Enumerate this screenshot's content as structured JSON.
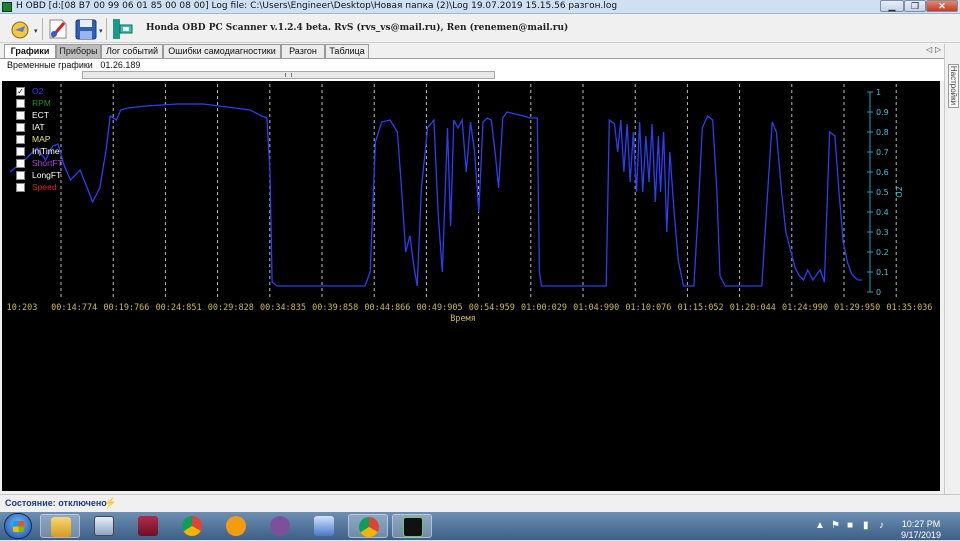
{
  "window": {
    "title": "H OBD [d:[08 B7 00 99 06 01 85 00 08 00] Log file: C:\\Users\\Engineer\\Desktop\\Новая папка (2)\\Log 19.07.2019 15.15.56 разгон.log",
    "controls": [
      "minimize",
      "maximize",
      "close"
    ]
  },
  "toolbar": {
    "app_title": "Honda OBD PC Scanner v.1.2.4 beta. RvS (rvs_vs@mail.ru), Ren (renemen@mail.ru)",
    "icons": [
      "connect-icon",
      "disconnect-icon",
      "save-icon",
      "settings-icon"
    ]
  },
  "tabs": [
    {
      "label": "Графики",
      "active": true
    },
    {
      "label": "Приборы",
      "active": false
    },
    {
      "label": "Лог событий",
      "active": false
    },
    {
      "label": "Ошибки самодиагностики",
      "active": false
    },
    {
      "label": "Разгон",
      "active": false
    },
    {
      "label": "Таблица",
      "active": false
    }
  ],
  "subheader": {
    "label": "Временные графики",
    "time": "01.26.189"
  },
  "side_panel": {
    "label": "Настройки"
  },
  "legend": [
    {
      "label": "O2",
      "checked": true,
      "color": "#2c3ff0"
    },
    {
      "label": "RPM",
      "checked": false,
      "color": "#2a8a2a"
    },
    {
      "label": "ECT",
      "checked": false,
      "color": "#ffffff"
    },
    {
      "label": "IAT",
      "checked": false,
      "color": "#ffffff"
    },
    {
      "label": "MAP",
      "checked": false,
      "color": "#e8e27a"
    },
    {
      "label": "InjTime",
      "checked": false,
      "color": "#ffffff"
    },
    {
      "label": "ShortFT",
      "checked": false,
      "color": "#b040e0"
    },
    {
      "label": "LongFT",
      "checked": false,
      "color": "#ffffff"
    },
    {
      "label": "Speed",
      "checked": false,
      "color": "#e02020"
    }
  ],
  "chart_data": {
    "type": "line",
    "xlabel": "Время",
    "ylabel": "O2",
    "ylim": [
      0,
      1
    ],
    "x_ticks": [
      "10:203",
      "00:14:774",
      "00:19:766",
      "00:24:851",
      "00:29:828",
      "00:34:835",
      "00:39:858",
      "00:44:866",
      "00:49:905",
      "00:54:959",
      "01:00:029",
      "01:04:990",
      "01:10:076",
      "01:15:052",
      "01:20:044",
      "01:24:990",
      "01:29:950",
      "01:35:036"
    ],
    "y_ticks": [
      "0",
      "0.1",
      "0.2",
      "0.3",
      "0.4",
      "0.5",
      "0.6",
      "0.7",
      "0.8",
      "0.9",
      "1"
    ],
    "grid": true,
    "series": [
      {
        "name": "O2",
        "color": "#2c3ff0",
        "points": [
          [
            0,
            0.6
          ],
          [
            1.4,
            0.66
          ],
          [
            2.6,
            0.72
          ],
          [
            3.4,
            0.66
          ],
          [
            4.1,
            0.73
          ],
          [
            4.6,
            0.74
          ],
          [
            5.2,
            0.63
          ],
          [
            5.8,
            0.56
          ],
          [
            6.7,
            0.61
          ],
          [
            7.4,
            0.52
          ],
          [
            7.9,
            0.45
          ],
          [
            8.6,
            0.52
          ],
          [
            9.2,
            0.71
          ],
          [
            9.6,
            0.88
          ],
          [
            10.2,
            0.86
          ],
          [
            10.6,
            0.91
          ],
          [
            11.3,
            0.92
          ],
          [
            13.0,
            0.93
          ],
          [
            16.0,
            0.94
          ],
          [
            18.5,
            0.94
          ],
          [
            20.0,
            0.93
          ],
          [
            21.6,
            0.92
          ],
          [
            23.0,
            0.91
          ],
          [
            24.1,
            0.88
          ],
          [
            24.6,
            0.87
          ],
          [
            24.9,
            0.6
          ],
          [
            25.1,
            0.05
          ],
          [
            25.6,
            0.03
          ],
          [
            30.0,
            0.03
          ],
          [
            34.0,
            0.03
          ],
          [
            34.5,
            0.1
          ],
          [
            35.0,
            0.75
          ],
          [
            35.6,
            0.85
          ],
          [
            36.4,
            0.86
          ],
          [
            37.1,
            0.8
          ],
          [
            37.5,
            0.52
          ],
          [
            37.9,
            0.2
          ],
          [
            38.3,
            0.28
          ],
          [
            38.7,
            0.12
          ],
          [
            39.0,
            0.03
          ],
          [
            39.4,
            0.52
          ],
          [
            40.0,
            0.82
          ],
          [
            40.6,
            0.86
          ],
          [
            41.0,
            0.4
          ],
          [
            41.4,
            0.1
          ],
          [
            41.9,
            0.82
          ],
          [
            42.2,
            0.33
          ],
          [
            42.5,
            0.86
          ],
          [
            42.9,
            0.82
          ],
          [
            43.3,
            0.86
          ],
          [
            43.7,
            0.6
          ],
          [
            44.1,
            0.85
          ],
          [
            44.5,
            0.7
          ],
          [
            44.9,
            0.4
          ],
          [
            45.3,
            0.85
          ],
          [
            45.7,
            0.87
          ],
          [
            46.1,
            0.86
          ],
          [
            46.5,
            0.68
          ],
          [
            46.8,
            0.52
          ],
          [
            47.2,
            0.87
          ],
          [
            47.6,
            0.9
          ],
          [
            48.4,
            0.89
          ],
          [
            49.2,
            0.88
          ],
          [
            49.8,
            0.87
          ],
          [
            50.5,
            0.87
          ],
          [
            50.7,
            0.1
          ],
          [
            50.9,
            0.03
          ],
          [
            55.0,
            0.03
          ],
          [
            57.1,
            0.03
          ],
          [
            57.4,
            0.86
          ],
          [
            57.9,
            0.84
          ],
          [
            58.2,
            0.7
          ],
          [
            58.5,
            0.86
          ],
          [
            58.8,
            0.6
          ],
          [
            59.1,
            0.84
          ],
          [
            59.4,
            0.55
          ],
          [
            59.7,
            0.8
          ],
          [
            60.0,
            0.5
          ],
          [
            60.3,
            0.85
          ],
          [
            60.6,
            0.5
          ],
          [
            60.9,
            0.78
          ],
          [
            61.2,
            0.55
          ],
          [
            61.5,
            0.84
          ],
          [
            61.8,
            0.45
          ],
          [
            62.1,
            0.78
          ],
          [
            62.3,
            0.5
          ],
          [
            62.6,
            0.8
          ],
          [
            62.9,
            0.3
          ],
          [
            63.2,
            0.7
          ],
          [
            63.6,
            0.4
          ],
          [
            64.0,
            0.16
          ],
          [
            64.5,
            0.03
          ],
          [
            65.5,
            0.03
          ],
          [
            65.9,
            0.4
          ],
          [
            66.3,
            0.82
          ],
          [
            66.8,
            0.88
          ],
          [
            67.3,
            0.86
          ],
          [
            67.7,
            0.5
          ],
          [
            68.0,
            0.08
          ],
          [
            68.5,
            0.03
          ],
          [
            72.0,
            0.03
          ],
          [
            72.5,
            0.45
          ],
          [
            73.0,
            0.85
          ],
          [
            73.4,
            0.8
          ],
          [
            73.9,
            0.5
          ],
          [
            74.3,
            0.3
          ],
          [
            74.8,
            0.2
          ],
          [
            75.2,
            0.12
          ],
          [
            75.6,
            0.08
          ],
          [
            76.0,
            0.06
          ],
          [
            76.4,
            0.11
          ],
          [
            76.9,
            0.06
          ],
          [
            77.3,
            0.09
          ],
          [
            77.6,
            0.11
          ],
          [
            78.0,
            0.05
          ],
          [
            78.5,
            0.8
          ],
          [
            79.0,
            0.78
          ],
          [
            79.4,
            0.5
          ],
          [
            79.8,
            0.25
          ],
          [
            80.2,
            0.15
          ],
          [
            80.6,
            0.09
          ],
          [
            81.2,
            0.06
          ],
          [
            81.6,
            0.06
          ]
        ]
      }
    ]
  },
  "status": {
    "text": "Состояние: отключено"
  },
  "taskbar": {
    "apps": [
      "explorer-icon",
      "calculator-icon",
      "winrar-icon",
      "chrome-icon",
      "aimp-icon",
      "viber-icon",
      "network-icon",
      "chrome-icon",
      "obd-scanner-icon"
    ],
    "time": "10:27 PM",
    "date": "9/17/2019"
  }
}
